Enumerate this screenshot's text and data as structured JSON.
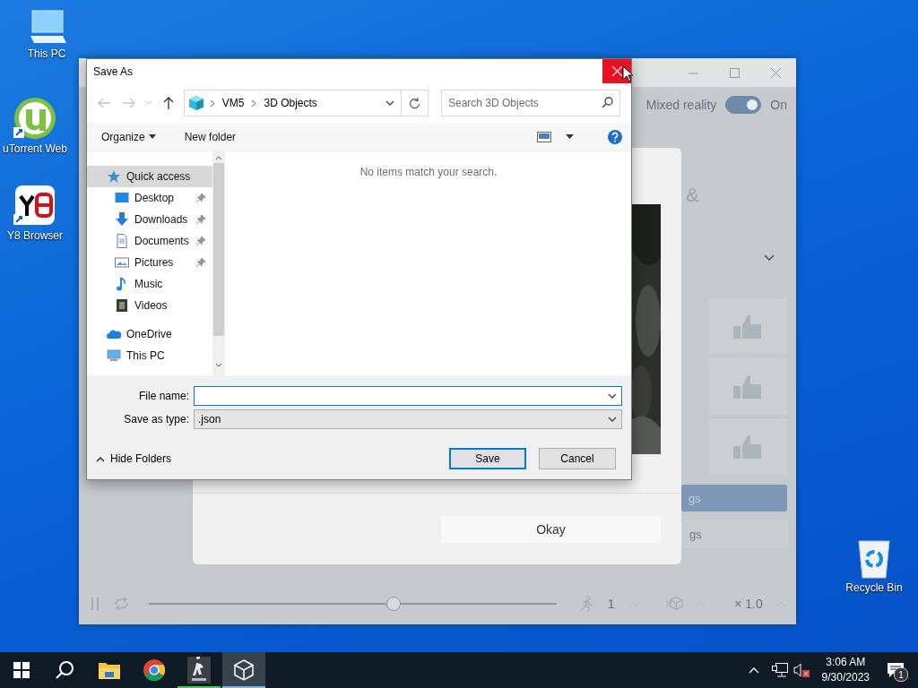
{
  "desktop_icons": [
    {
      "label": "This PC",
      "kind": "pc"
    },
    {
      "label": "uTorrent Web",
      "kind": "utorrent"
    },
    {
      "label": "Y8 Browser",
      "kind": "y8"
    },
    {
      "label": "Recycle Bin",
      "kind": "bin"
    }
  ],
  "viewer_window": {
    "mixed_reality": {
      "label": "Mixed reality",
      "on": true,
      "state": "On"
    },
    "heading_fragment": "&",
    "okay_button": "Okay",
    "side_buttons": [
      {
        "label": "gs",
        "kind": "primary"
      },
      {
        "label": "gs",
        "kind": "secondary"
      }
    ],
    "playback": {
      "level": 0.6,
      "animation_count": "1",
      "speed": "× 1.0"
    }
  },
  "save_dialog": {
    "title": "Save As",
    "breadcrumb": [
      "VM5",
      "3D Objects"
    ],
    "search": {
      "placeholder": "Search 3D Objects"
    },
    "toolbar": {
      "organize": "Organize",
      "new_folder": "New folder"
    },
    "nav_items": [
      {
        "label": "Quick access",
        "kind": "star",
        "selected": true,
        "children": [
          {
            "label": "Desktop",
            "kind": "desktop",
            "selected": false,
            "pinned": true
          },
          {
            "label": "Downloads",
            "kind": "downloads",
            "selected": false,
            "pinned": true
          },
          {
            "label": "Documents",
            "kind": "documents",
            "selected": false,
            "pinned": true
          },
          {
            "label": "Pictures",
            "kind": "pictures",
            "selected": false,
            "pinned": true
          },
          {
            "label": "Music",
            "kind": "music",
            "selected": false,
            "pinned": false
          },
          {
            "label": "Videos",
            "kind": "videos",
            "selected": false,
            "pinned": false
          }
        ]
      },
      {
        "label": "OneDrive",
        "kind": "cloud",
        "selected": false
      },
      {
        "label": "This PC",
        "kind": "pc",
        "selected": false
      }
    ],
    "empty_message": "No items match your search.",
    "file_name": {
      "label": "File name:"
    },
    "save_type": {
      "label": "Save as type:",
      "value": ".json"
    },
    "hide_folders": "Hide Folders",
    "buttons": [
      {
        "label": "Save",
        "kind": "default"
      },
      {
        "label": "Cancel",
        "kind": "normal"
      }
    ]
  },
  "taskbar": {
    "apps": [
      {
        "kind": "explorer",
        "running": false,
        "active": false
      },
      {
        "kind": "chrome",
        "running": false,
        "active": false
      },
      {
        "kind": "game",
        "running": true,
        "active": false
      },
      {
        "kind": "viewer3d",
        "running": true,
        "active": true
      }
    ],
    "clock": {
      "time": "3:06 AM",
      "date": "9/30/2023"
    },
    "notification_count": "1"
  }
}
